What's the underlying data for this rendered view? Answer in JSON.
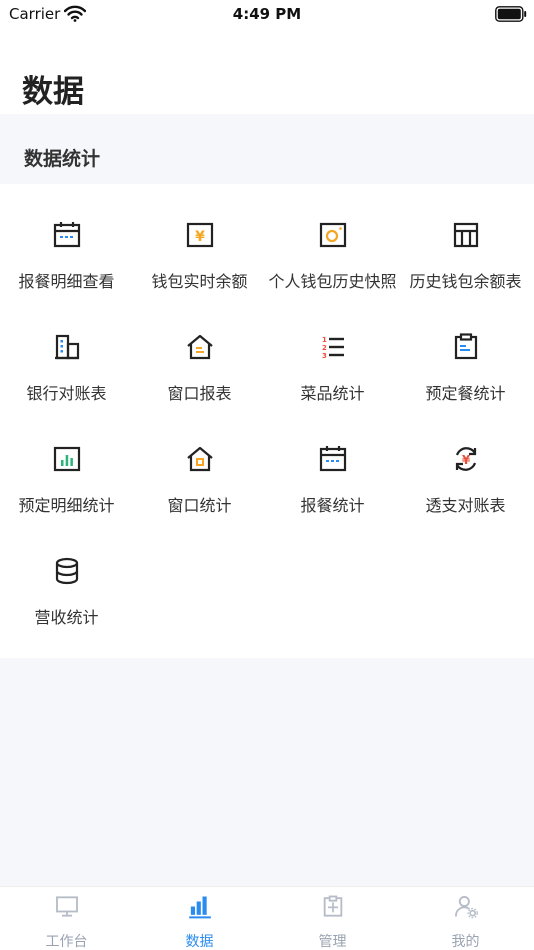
{
  "status_bar": {
    "carrier": "Carrier",
    "time": "4:49 PM"
  },
  "page": {
    "title": "数据"
  },
  "section": {
    "title": "数据统计"
  },
  "colors": {
    "accent": "#2a8cf0",
    "highlight": "#f5a623",
    "alert": "#e8503a",
    "inactive": "#b5bcc8"
  },
  "items": [
    {
      "label": "报餐明细查看",
      "icon": "calendar-icon"
    },
    {
      "label": "钱包实时余额",
      "icon": "wallet-yen-icon"
    },
    {
      "label": "个人钱包历史快照",
      "icon": "camera-icon"
    },
    {
      "label": "历史钱包余额表",
      "icon": "table-icon"
    },
    {
      "label": "银行对账表",
      "icon": "bank-building-icon"
    },
    {
      "label": "窗口报表",
      "icon": "window-house-icon"
    },
    {
      "label": "菜品统计",
      "icon": "numbered-list-icon"
    },
    {
      "label": "预定餐统计",
      "icon": "clipboard-icon"
    },
    {
      "label": "预定明细统计",
      "icon": "bar-chart-icon"
    },
    {
      "label": "窗口统计",
      "icon": "window-house-icon"
    },
    {
      "label": "报餐统计",
      "icon": "calendar-icon"
    },
    {
      "label": "透支对账表",
      "icon": "refresh-yen-icon"
    },
    {
      "label": "营收统计",
      "icon": "database-icon"
    }
  ],
  "tabs": [
    {
      "label": "工作台",
      "icon": "monitor-icon",
      "active": false
    },
    {
      "label": "数据",
      "icon": "bar-chart-icon",
      "active": true
    },
    {
      "label": "管理",
      "icon": "clipboard-manage-icon",
      "active": false
    },
    {
      "label": "我的",
      "icon": "user-settings-icon",
      "active": false
    }
  ]
}
